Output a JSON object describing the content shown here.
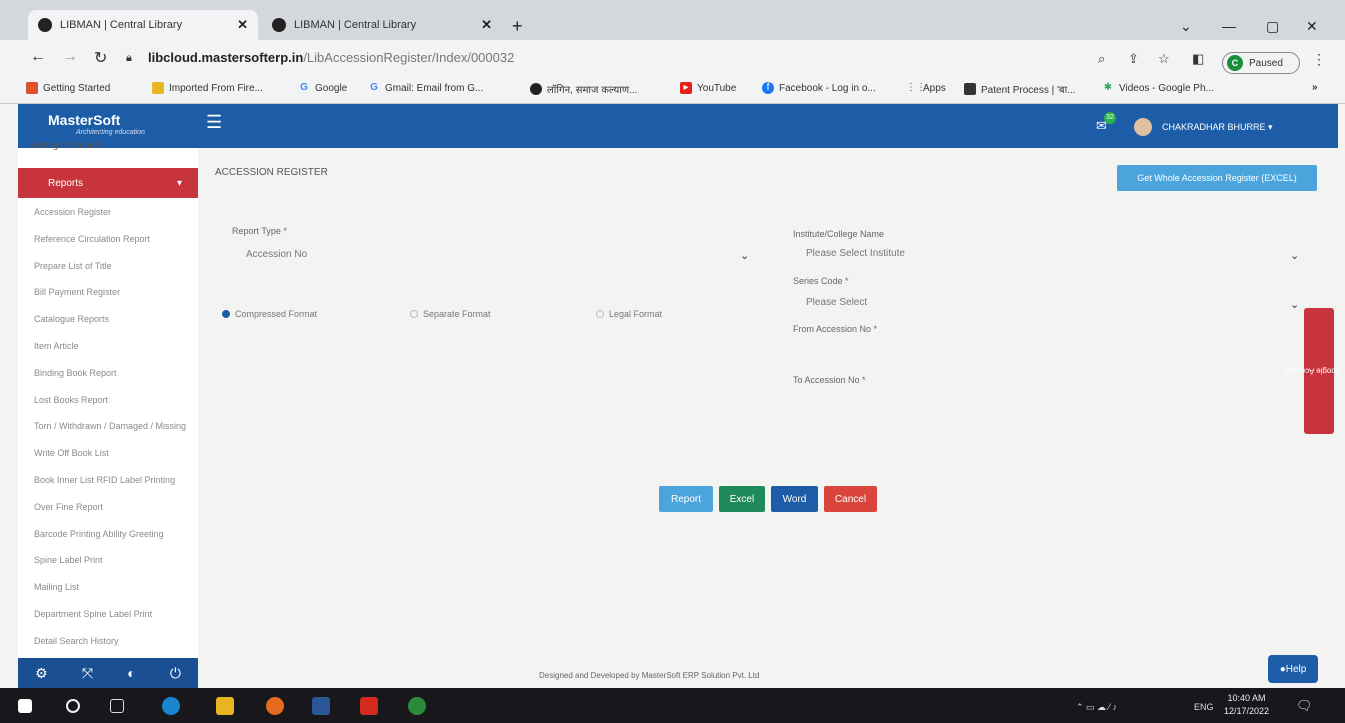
{
  "browser": {
    "tabs": [
      {
        "title": "LIBMAN | Central Library"
      },
      {
        "title": "LIBMAN | Central Library"
      }
    ],
    "url_domain": "libcloud.mastersofterp.in",
    "url_path": "/LibAccessionRegister/Index/000032",
    "profile_initial": "C",
    "profile_status": "Paused",
    "bookmarks": [
      {
        "label": "Getting Started",
        "color": "#e0522b"
      },
      {
        "label": "Imported From Fire...",
        "color": "#e8b520"
      },
      {
        "label": "Google",
        "color": "#4285f4"
      },
      {
        "label": "Gmail: Email from G...",
        "color": "#4285f4"
      },
      {
        "label": "लॉगिन, समाज कल्याण...",
        "color": "#222222"
      },
      {
        "label": "YouTube",
        "color": "#e62117"
      },
      {
        "label": "Facebook - Log in o...",
        "color": "#1877f2"
      },
      {
        "label": "Apps",
        "color": "#555555"
      },
      {
        "label": "Patent Process | 'बा...",
        "color": "#333333"
      },
      {
        "label": "Videos - Google Ph...",
        "color": "#34a853"
      }
    ]
  },
  "app": {
    "logo": "MasterSoft",
    "logo_tagline": "Architecting education",
    "notification_count": "32",
    "user_name": "CHAKRADHAR BHURRE",
    "sidebar_top": "Settings & Search",
    "sidebar_active": "Reports",
    "sidebar_items": [
      "Accession Register",
      "Reference Circulation Report",
      "Prepare List of Title",
      "Bill Payment Register",
      "Catalogue Reports",
      "Item Article",
      "Binding Book Report",
      "Lost Books Report",
      "Torn / Withdrawn / Damaged / Missing",
      "Write Off Book List",
      "Book Inner List RFID Label Printing",
      "Over Fine Report",
      "Barcode Printing Ability Greeting",
      "Spine Label Print",
      "Mailing List",
      "Department Spine Label Print",
      "Detail Search History"
    ],
    "page_title": "ACCESSION REGISTER",
    "excel_whole_button": "Get Whole Accession Register (EXCEL)",
    "form": {
      "report_type_label": "Report Type *",
      "report_type_value": "Accession No",
      "format_options": [
        {
          "label": "Compressed Format",
          "selected": true
        },
        {
          "label": "Separate Format",
          "selected": false
        },
        {
          "label": "Legal Format",
          "selected": false
        }
      ],
      "institute_label": "Institute/College Name",
      "institute_value": "Please Select Institute",
      "series_label": "Series Code *",
      "series_value": "Please Select",
      "from_label": "From Accession No *",
      "to_label": "To Accession No *"
    },
    "buttons": {
      "report": "Report",
      "excel": "Excel",
      "word": "Word",
      "cancel": "Cancel"
    },
    "sync_label": "Sync Google Account",
    "footer": "Designed and Developed by MasterSoft ERP Solution Pvt. Ltd",
    "help": "Help"
  },
  "colors": {
    "header_blue": "#1d5ca6",
    "accent_red": "#c8343b",
    "report_btn": "#4ba4dc",
    "excel_btn": "#1e8a5a",
    "word_btn": "#1d5ca6",
    "cancel_btn": "#d9453d"
  },
  "taskbar": {
    "language": "ENG",
    "time": "10:40 AM",
    "date": "12/17/2022"
  }
}
